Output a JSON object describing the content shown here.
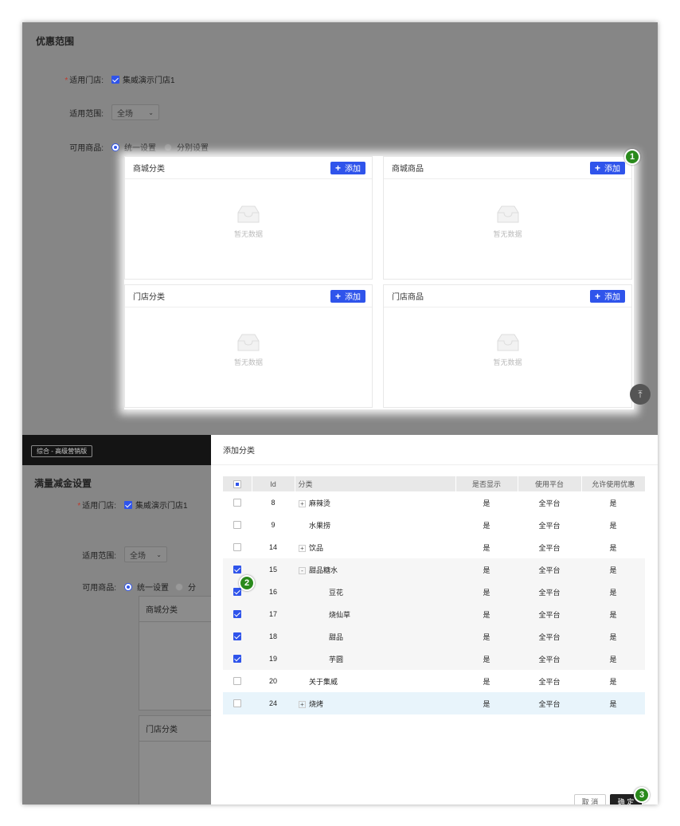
{
  "top": {
    "title": "优惠范围",
    "store_label": "适用门店:",
    "store_value": "集威演示门店1",
    "scope_label": "适用范围:",
    "scope_value": "全场",
    "goods_label": "可用商品:",
    "radio_unified": "统一设置",
    "radio_separate": "分别设置",
    "panels": [
      {
        "title": "商城分类",
        "add": "添加",
        "empty": "暂无数据"
      },
      {
        "title": "商城商品",
        "add": "添加",
        "empty": "暂无数据"
      },
      {
        "title": "门店分类",
        "add": "添加",
        "empty": "暂无数据"
      },
      {
        "title": "门店商品",
        "add": "添加",
        "empty": "暂无数据"
      }
    ],
    "step_badge": "1"
  },
  "bottom": {
    "version_tag": "综合 - 高级营销版",
    "page_title": "满量减金设置",
    "store_label": "适用门店:",
    "store_value": "集威演示门店1",
    "scope_label": "适用范围:",
    "scope_value": "全场",
    "goods_label": "可用商品:",
    "radio_unified": "统一设置",
    "radio_separate": "分",
    "panel_a": "商城分类",
    "panel_b": "门店分类"
  },
  "dialog": {
    "title": "添加分类",
    "columns": [
      "Id",
      "分类",
      "是否显示",
      "使用平台",
      "允许使用优惠"
    ],
    "rows": [
      {
        "checked": false,
        "id": "8",
        "name": "麻辣烫",
        "expander": "+",
        "indent": 0,
        "show": "是",
        "platform": "全平台",
        "discount": "是"
      },
      {
        "checked": false,
        "id": "9",
        "name": "水果捞",
        "expander": "",
        "indent": 0,
        "show": "是",
        "platform": "全平台",
        "discount": "是"
      },
      {
        "checked": false,
        "id": "14",
        "name": "饮品",
        "expander": "+",
        "indent": 0,
        "show": "是",
        "platform": "全平台",
        "discount": "是"
      },
      {
        "checked": true,
        "id": "15",
        "name": "甜品糖水",
        "expander": "-",
        "indent": 0,
        "show": "是",
        "platform": "全平台",
        "discount": "是"
      },
      {
        "checked": true,
        "id": "16",
        "name": "豆花",
        "expander": "",
        "indent": 1,
        "show": "是",
        "platform": "全平台",
        "discount": "是"
      },
      {
        "checked": true,
        "id": "17",
        "name": "烧仙草",
        "expander": "",
        "indent": 1,
        "show": "是",
        "platform": "全平台",
        "discount": "是"
      },
      {
        "checked": true,
        "id": "18",
        "name": "甜品",
        "expander": "",
        "indent": 1,
        "show": "是",
        "platform": "全平台",
        "discount": "是"
      },
      {
        "checked": true,
        "id": "19",
        "name": "芋圆",
        "expander": "",
        "indent": 1,
        "show": "是",
        "platform": "全平台",
        "discount": "是"
      },
      {
        "checked": false,
        "id": "20",
        "name": "关于集威",
        "expander": "",
        "indent": 0,
        "show": "是",
        "platform": "全平台",
        "discount": "是"
      },
      {
        "checked": false,
        "id": "24",
        "name": "烧烤",
        "expander": "+",
        "indent": 0,
        "show": "是",
        "platform": "全平台",
        "discount": "是"
      }
    ],
    "cancel": "取 消",
    "confirm": "确 定",
    "step_badge_2": "2",
    "step_badge_3": "3"
  },
  "colors": {
    "accent": "#2f54eb",
    "badge": "#2a8a1c",
    "overlay": "#868686"
  }
}
